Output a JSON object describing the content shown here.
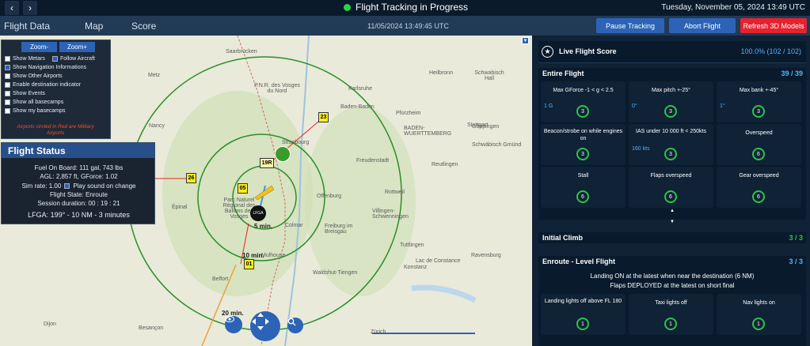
{
  "top": {
    "back_glyph": "‹",
    "forward_glyph": "›",
    "status_title": "Flight Tracking in Progress",
    "status_color": "#2fd04a",
    "datetime": "Tuesday, November 05, 2024 13:49 UTC"
  },
  "menu": {
    "items": [
      "Flight Data",
      "Map",
      "Score"
    ],
    "center_datetime": "11/05/2024 13:49:45 UTC",
    "pause_label": "Pause Tracking",
    "abort_label": "Abort Flight",
    "refresh_label": "Refresh 3D Models",
    "accent": "#2c63b6",
    "danger": "#e5222e"
  },
  "map": {
    "zoom_minus": "Zoom-",
    "zoom_plus": "Zoom+",
    "options": [
      {
        "label": "Show Metars",
        "checked": false
      },
      {
        "label": "Follow Aircraft",
        "checked": true
      },
      {
        "label": "Show Navigation Informations",
        "checked": true
      },
      {
        "label": "Show Other Airports",
        "checked": false
      },
      {
        "label": "Enable destination indicator",
        "checked": false
      },
      {
        "label": "Show Events",
        "checked": false
      },
      {
        "label": "Show all basecamps",
        "checked": false
      },
      {
        "label": "Show my basecamps",
        "checked": false
      }
    ],
    "military_note": "Airports circled in Red are Military Airports",
    "places": [
      "Saarbrücken",
      "Metz",
      "Nancy",
      "Épinal",
      "Strasbourg",
      "Stuttgart",
      "Heilbronn",
      "Schwabisch Hall",
      "Pforzheim",
      "Karlsruhe",
      "Baden-Baden",
      "Freudenstadt",
      "Freiburg im Breisgau",
      "Mulhouse",
      "Belfort",
      "Besançon",
      "Ravensburg",
      "BADEN-WUERTTEMBERG",
      "Reutlingen",
      "Göppingen",
      "Offenburg",
      "Colmar",
      "Villingen-Schwenningen",
      "Konstanz",
      "Waldshut-Tiengen",
      "Zürich",
      "Dijon",
      "Schwäbisch Gmünd",
      "Rottweil",
      "Tuttlingen",
      "Lac de Constance"
    ],
    "markers": [
      "23",
      "26",
      "05",
      "01",
      "19R"
    ],
    "airport_code": "LFGA",
    "airport_time": "5 min.",
    "time_labels": [
      "10 min.",
      "20 min."
    ],
    "park_label": "P.N.R. des Vosges du Nord",
    "park_label2": "Parc Naturel Régional des Ballons des Vosges"
  },
  "flight_status": {
    "title": "Flight Status",
    "fuel": "Fuel On Board: 111 gal, 743  lbs",
    "agl": "AGL: 2,857 ft, GForce: 1.02",
    "sim_rate_label": "Sim rate: 1.00",
    "play_sound": "Play sound on change",
    "play_sound_checked": true,
    "state": "Flight State: Enroute",
    "session": "Session duration: 00 : 19 : 21",
    "lfga": "LFGA: 199° - 10 NM - 3 minutes"
  },
  "score": {
    "title": "Live Flight Score",
    "value": "100.0% (102 / 102)",
    "entire": {
      "title": "Entire Flight",
      "count": "39 / 39",
      "cards": [
        {
          "title": "Max GForce -1 < g < 2.5",
          "sub": "1 G",
          "score": "3"
        },
        {
          "title": "Max pitch +-25°",
          "sub": "0°",
          "score": "3"
        },
        {
          "title": "Max bank +-45°",
          "sub": "1°",
          "score": "3"
        },
        {
          "title": "Beacon/strobe on while engines on",
          "sub": "",
          "score": "3"
        },
        {
          "title": "IAS under 10 000 ft < 250kts",
          "sub": "160 kts",
          "score": "3"
        },
        {
          "title": "Overspeed",
          "sub": "",
          "score": "6"
        },
        {
          "title": "Stall",
          "sub": "",
          "score": "6"
        },
        {
          "title": "Flaps overspeed",
          "sub": "",
          "score": "6"
        },
        {
          "title": "Gear overspeed",
          "sub": "",
          "score": "6"
        }
      ]
    },
    "climb": {
      "title": "Initial Climb",
      "count": "3 / 3"
    },
    "enroute": {
      "title": "Enroute - Level Flight",
      "count": "3 / 3",
      "note1": "Landing ON at the latest when near the destination (6 NM)",
      "note2": "Flaps DEPLOYED at the latest on short final",
      "cards": [
        {
          "title": "Landing lights off above FL 180",
          "score": "1"
        },
        {
          "title": "Taxi lights off",
          "score": "1"
        },
        {
          "title": "Nav lights on",
          "score": "1"
        }
      ]
    },
    "ring_color": "#2ec24b",
    "count_color": "#4fb5ff"
  }
}
